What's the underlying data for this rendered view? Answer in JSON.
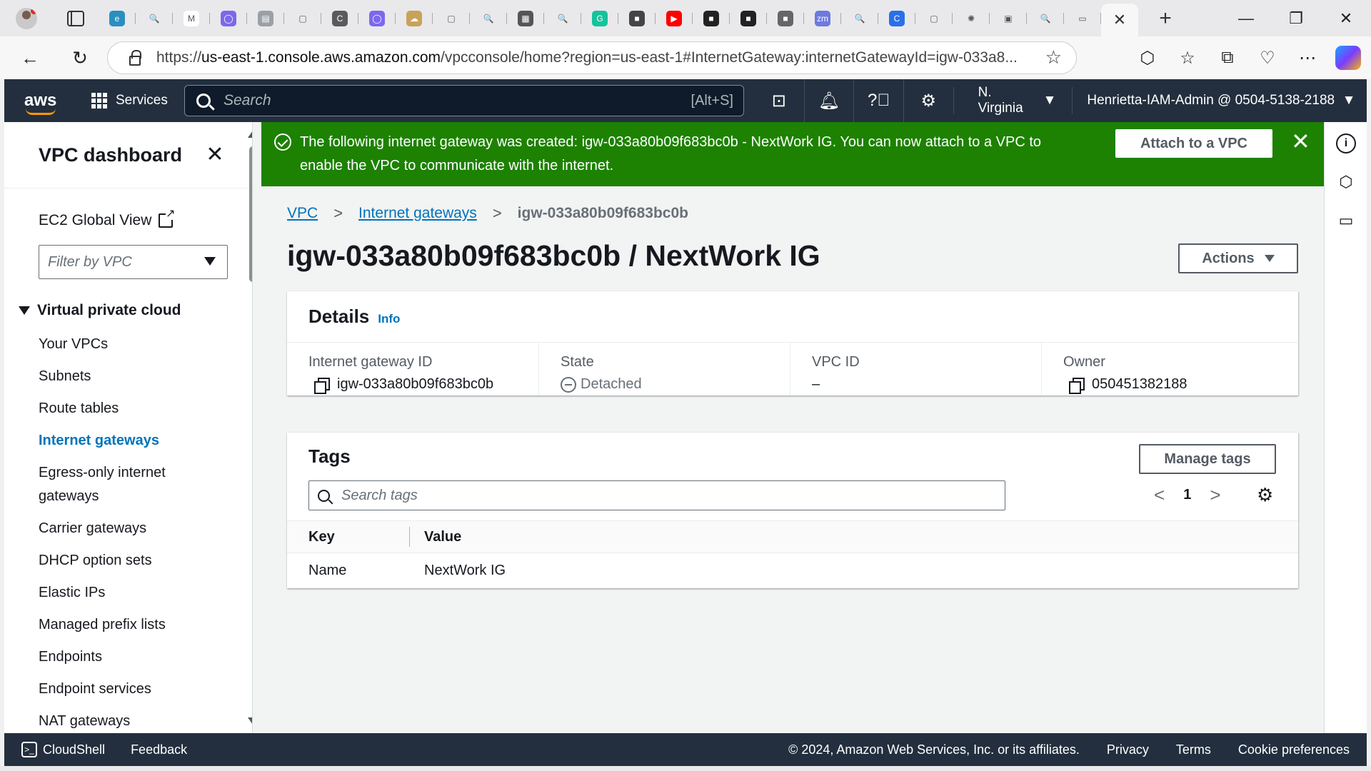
{
  "browser": {
    "favicons": [
      {
        "name": "edge-tab-icon",
        "bg": "#2a8fbf",
        "glyph": "e"
      },
      {
        "name": "search-tab-icon",
        "bg": "transparent",
        "glyph": "🔍"
      },
      {
        "name": "gmail-tab-icon",
        "bg": "#ffffff",
        "glyph": "M"
      },
      {
        "name": "chat-tab-icon",
        "bg": "#7b68ee",
        "glyph": "◯"
      },
      {
        "name": "app-tab-icon",
        "bg": "#9aa0a6",
        "glyph": "▤"
      },
      {
        "name": "doc-tab-icon",
        "bg": "transparent",
        "glyph": "▢"
      },
      {
        "name": "copilot-tab-icon",
        "bg": "#5a5a5a",
        "glyph": "C"
      },
      {
        "name": "chat2-tab-icon",
        "bg": "#7b68ee",
        "glyph": "◯"
      },
      {
        "name": "cloud-tab-icon",
        "bg": "#c9a25a",
        "glyph": "☁"
      },
      {
        "name": "page-tab-icon",
        "bg": "transparent",
        "glyph": "▢"
      },
      {
        "name": "search2-tab-icon",
        "bg": "transparent",
        "glyph": "🔍"
      },
      {
        "name": "film-tab-icon",
        "bg": "#555555",
        "glyph": "▦"
      },
      {
        "name": "search3-tab-icon",
        "bg": "transparent",
        "glyph": "🔍"
      },
      {
        "name": "grammarly-tab-icon",
        "bg": "#15c39a",
        "glyph": "G"
      },
      {
        "name": "box-tab-icon",
        "bg": "#444444",
        "glyph": "■"
      },
      {
        "name": "youtube-tab-icon",
        "bg": "#ff0000",
        "glyph": "▶"
      },
      {
        "name": "box2-tab-icon",
        "bg": "#222222",
        "glyph": "■"
      },
      {
        "name": "box3-tab-icon",
        "bg": "#222222",
        "glyph": "■"
      },
      {
        "name": "box4-tab-icon",
        "bg": "#666666",
        "glyph": "■"
      },
      {
        "name": "zoom-tab-icon",
        "bg": "#6c7ae0",
        "glyph": "zm"
      },
      {
        "name": "search4-tab-icon",
        "bg": "transparent",
        "glyph": "🔍"
      },
      {
        "name": "copilot2-tab-icon",
        "bg": "#2a6fe8",
        "glyph": "C"
      },
      {
        "name": "page2-tab-icon",
        "bg": "transparent",
        "glyph": "▢"
      },
      {
        "name": "openai-tab-icon",
        "bg": "transparent",
        "glyph": "✺"
      },
      {
        "name": "window-tab-icon",
        "bg": "transparent",
        "glyph": "▣"
      },
      {
        "name": "search5-tab-icon",
        "bg": "transparent",
        "glyph": "🔍"
      },
      {
        "name": "folder-tab-icon",
        "bg": "transparent",
        "glyph": "▭"
      }
    ],
    "url_prefix": "https://",
    "url_host": "us-east-1.console.aws.amazon.com",
    "url_path": "/vpcconsole/home?region=us-east-1#InternetGateway:internetGatewayId=igw-033a8..."
  },
  "aws": {
    "services_label": "Services",
    "search_placeholder": "Search",
    "search_shortcut": "[Alt+S]",
    "region": "N. Virginia",
    "account": "Henrietta-IAM-Admin @ 0504-5138-2188"
  },
  "sidebar": {
    "title": "VPC dashboard",
    "ec2_global_view": "EC2 Global View",
    "filter_placeholder": "Filter by VPC",
    "section_title": "Virtual private cloud",
    "items": [
      {
        "label": "Your VPCs",
        "active": false
      },
      {
        "label": "Subnets",
        "active": false
      },
      {
        "label": "Route tables",
        "active": false
      },
      {
        "label": "Internet gateways",
        "active": true
      },
      {
        "label": "Egress-only internet gateways",
        "active": false
      },
      {
        "label": "Carrier gateways",
        "active": false
      },
      {
        "label": "DHCP option sets",
        "active": false
      },
      {
        "label": "Elastic IPs",
        "active": false
      },
      {
        "label": "Managed prefix lists",
        "active": false
      },
      {
        "label": "Endpoints",
        "active": false
      },
      {
        "label": "Endpoint services",
        "active": false
      },
      {
        "label": "NAT gateways",
        "active": false
      }
    ]
  },
  "flash": {
    "message": "The following internet gateway was created: igw-033a80b09f683bc0b - NextWork IG. You can now attach to a VPC to enable the VPC to communicate with the internet.",
    "attach_label": "Attach to a VPC",
    "color": "#1d8102"
  },
  "breadcrumb": {
    "root": "VPC",
    "parent": "Internet gateways",
    "current": "igw-033a80b09f683bc0b"
  },
  "page": {
    "title": "igw-033a80b09f683bc0b / NextWork IG",
    "actions_label": "Actions"
  },
  "details": {
    "heading": "Details",
    "info_label": "Info",
    "fields": {
      "igw_id_label": "Internet gateway ID",
      "igw_id_value": "igw-033a80b09f683bc0b",
      "state_label": "State",
      "state_value": "Detached",
      "vpc_label": "VPC ID",
      "vpc_value": "–",
      "owner_label": "Owner",
      "owner_value": "050451382188"
    }
  },
  "tags": {
    "heading": "Tags",
    "manage_label": "Manage tags",
    "search_placeholder": "Search tags",
    "page_number": "1",
    "columns": {
      "key": "Key",
      "value": "Value"
    },
    "rows": [
      {
        "key": "Name",
        "value": "NextWork IG"
      }
    ]
  },
  "footer": {
    "cloudshell": "CloudShell",
    "feedback": "Feedback",
    "copyright": "© 2024, Amazon Web Services, Inc. or its affiliates.",
    "privacy": "Privacy",
    "terms": "Terms",
    "cookies": "Cookie preferences"
  }
}
